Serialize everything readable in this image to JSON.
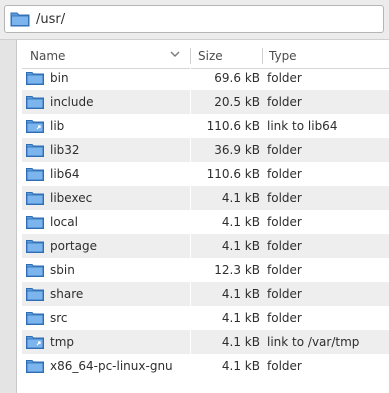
{
  "location": {
    "path": "/usr/",
    "icon": "folder-icon"
  },
  "columns": {
    "name": "Name",
    "size": "Size",
    "type": "Type",
    "sort_icon": "chevron-down-icon"
  },
  "colors": {
    "folder_blue": "#3b7dc9",
    "row_alt": "#eeeeee"
  },
  "files": [
    {
      "name": "bin",
      "size": "69.6 kB",
      "type": "folder",
      "link": false
    },
    {
      "name": "include",
      "size": "20.5 kB",
      "type": "folder",
      "link": false
    },
    {
      "name": "lib",
      "size": "110.6 kB",
      "type": "link to lib64",
      "link": true
    },
    {
      "name": "lib32",
      "size": "36.9 kB",
      "type": "folder",
      "link": false
    },
    {
      "name": "lib64",
      "size": "110.6 kB",
      "type": "folder",
      "link": false
    },
    {
      "name": "libexec",
      "size": "4.1 kB",
      "type": "folder",
      "link": false
    },
    {
      "name": "local",
      "size": "4.1 kB",
      "type": "folder",
      "link": false
    },
    {
      "name": "portage",
      "size": "4.1 kB",
      "type": "folder",
      "link": false
    },
    {
      "name": "sbin",
      "size": "12.3 kB",
      "type": "folder",
      "link": false
    },
    {
      "name": "share",
      "size": "4.1 kB",
      "type": "folder",
      "link": false
    },
    {
      "name": "src",
      "size": "4.1 kB",
      "type": "folder",
      "link": false
    },
    {
      "name": "tmp",
      "size": "4.1 kB",
      "type": "link to /var/tmp",
      "link": true
    },
    {
      "name": "x86_64-pc-linux-gnu",
      "size": "4.1 kB",
      "type": "folder",
      "link": false
    }
  ]
}
